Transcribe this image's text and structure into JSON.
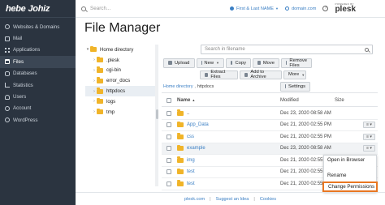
{
  "brand": {
    "part1": "hebe",
    "part2": "Johiz"
  },
  "sidebar": {
    "items": [
      {
        "label": "Websites & Domains",
        "icon": "globe-icon"
      },
      {
        "label": "Mail",
        "icon": "mail-icon"
      },
      {
        "label": "Applications",
        "icon": "apps-icon"
      },
      {
        "label": "Files",
        "icon": "folder-icon",
        "active": true
      },
      {
        "label": "Databases",
        "icon": "database-icon"
      },
      {
        "label": "Statistics",
        "icon": "chart-icon"
      },
      {
        "label": "Users",
        "icon": "users-icon"
      },
      {
        "label": "Account",
        "icon": "account-icon"
      },
      {
        "label": "WordPress",
        "icon": "wordpress-icon"
      }
    ]
  },
  "topbar": {
    "search_placeholder": "Search...",
    "user": "First & Last NAME",
    "domain": "domain.com",
    "help": "?",
    "logo_small": "POWERED BY",
    "logo_big": "plesk"
  },
  "page_title": "File Manager",
  "tree": {
    "root": "Home directory",
    "children": [
      ".plesk",
      "cgi-bin",
      "error_docs",
      "httpdocs",
      "logs",
      "tmp"
    ]
  },
  "file_search": {
    "placeholder": "Search in filename"
  },
  "toolbar": {
    "upload": "Upload",
    "new": "New",
    "copy": "Copy",
    "move": "Move",
    "remove": "Remove Files",
    "extract": "Extract Files",
    "archive": "Add to Archive",
    "more": "More",
    "settings": "Settings"
  },
  "breadcrumb": {
    "home": "Home directory",
    "current": "httpdocs"
  },
  "table": {
    "col_name": "Name",
    "col_modified": "Modified",
    "col_size": "Size",
    "rows": [
      {
        "name": "..",
        "date": "Dec 23, 2020 08:58 AM"
      },
      {
        "name": "App_Data",
        "date": "Dec 21, 2020 02:55 PM"
      },
      {
        "name": "css",
        "date": "Dec 21, 2020 02:55 PM"
      },
      {
        "name": "example",
        "date": "Dec 23, 2020 08:58 AM"
      },
      {
        "name": "img",
        "date": "Dec 21, 2020 02:55 PM"
      },
      {
        "name": "test",
        "date": "Dec 21, 2020 02:55 PM"
      },
      {
        "name": "test",
        "date": "Dec 21, 2020 02:55 PM"
      }
    ]
  },
  "context_menu": {
    "open_browser": "Open in Browser",
    "rename": "Rename",
    "change_permissions": "Change Permissions"
  },
  "footer": {
    "link1": "plesk.com",
    "link2": "Suggest an Idea",
    "link3": "Cookies",
    "sep": "|"
  }
}
